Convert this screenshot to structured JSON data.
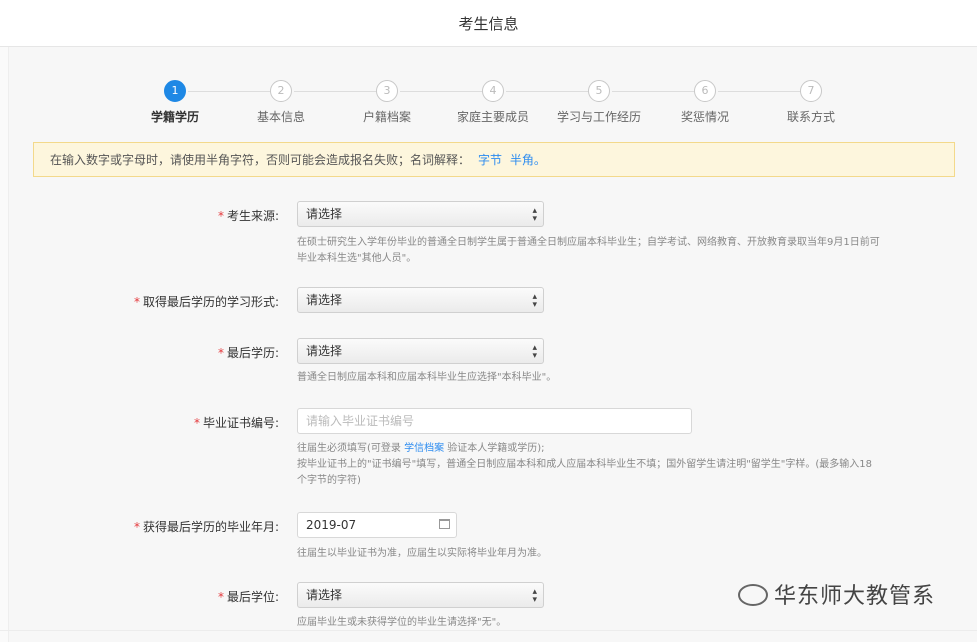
{
  "header": {
    "title": "考生信息"
  },
  "steps": [
    {
      "num": "1",
      "label": "学籍学历"
    },
    {
      "num": "2",
      "label": "基本信息"
    },
    {
      "num": "3",
      "label": "户籍档案"
    },
    {
      "num": "4",
      "label": "家庭主要成员"
    },
    {
      "num": "5",
      "label": "学习与工作经历"
    },
    {
      "num": "6",
      "label": "奖惩情况"
    },
    {
      "num": "7",
      "label": "联系方式"
    }
  ],
  "notice": {
    "text": "在输入数字或字母时，请使用半角字符，否则可能会造成报名失败；名词解释：",
    "link1": "字节",
    "link2": "半角。"
  },
  "form": {
    "source": {
      "label": "考生来源:",
      "value": "请选择",
      "hint": "在硕士研究生入学年份毕业的普通全日制学生属于普通全日制应届本科毕业生；自学考试、网络教育、开放教育录取当年9月1日前可毕业本科生选\"其他人员\"。"
    },
    "study_form": {
      "label": "取得最后学历的学习形式:",
      "value": "请选择"
    },
    "last_degree_edu": {
      "label": "最后学历:",
      "value": "请选择",
      "hint": "普通全日制应届本科和应届本科毕业生应选择\"本科毕业\"。"
    },
    "cert_no": {
      "label": "毕业证书编号:",
      "placeholder": "请输入毕业证书编号",
      "hint_pre": "往届生必须填写(可登录",
      "hint_link": "学信档案",
      "hint_post": "验证本人学籍或学历);",
      "hint2": "按毕业证书上的\"证书编号\"填写，普通全日制应届本科和成人应届本科毕业生不填；国外留学生请注明\"留学生\"字样。(最多输入18个字节的字符)"
    },
    "grad_date": {
      "label": "获得最后学历的毕业年月:",
      "value": "2019-07",
      "hint": "往届生以毕业证书为准，应届生以实际将毕业年月为准。"
    },
    "last_degree": {
      "label": "最后学位:",
      "value": "请选择",
      "hint": "应届毕业生或未获得学位的毕业生请选择\"无\"。"
    }
  },
  "watermark": {
    "text": "华东师大教管系"
  }
}
